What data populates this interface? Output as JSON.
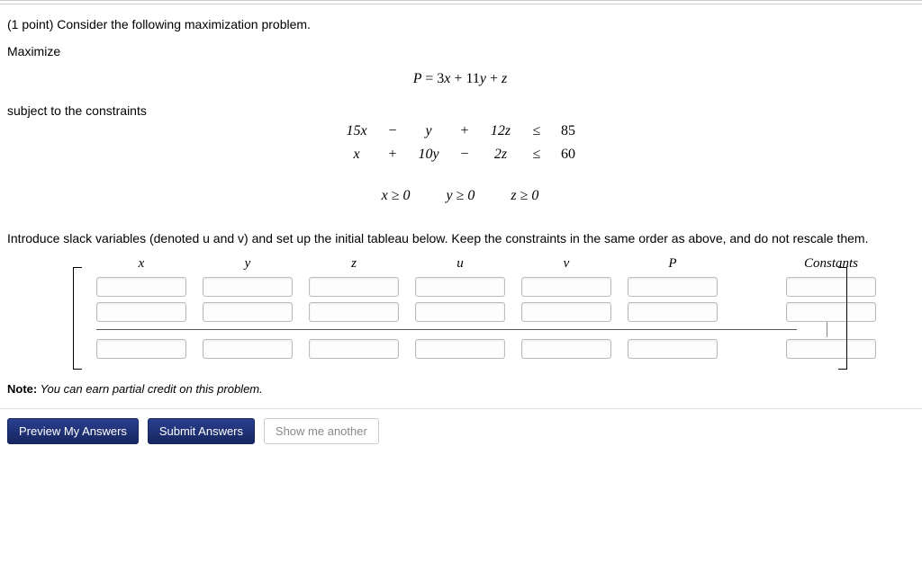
{
  "problem": {
    "points_prefix": "(1 point) ",
    "prompt": "Consider the following maximization problem.",
    "maximize_label": "Maximize",
    "objective": "P = 3x + 11y + z",
    "subject_label": "subject to the constraints",
    "constraints": {
      "r1": {
        "c1": "15x",
        "o1": "−",
        "c2": "y",
        "o2": "+",
        "c3": "12z",
        "rel": "≤",
        "rhs": "85"
      },
      "r2": {
        "c1": "x",
        "o1": "+",
        "c2": "10y",
        "o2": "−",
        "c3": "2z",
        "rel": "≤",
        "rhs": "60"
      }
    },
    "nonneg": {
      "a": "x ≥ 0",
      "b": "y ≥ 0",
      "c": "z ≥ 0"
    },
    "instruction": "Introduce slack variables (denoted u and v) and set up the initial tableau below. Keep the constraints in the same order as above, and do not rescale them.",
    "headers": {
      "x": "x",
      "y": "y",
      "z": "z",
      "u": "u",
      "v": "v",
      "P": "P",
      "const": "Constants"
    }
  },
  "note": {
    "label": "Note:",
    "text": " You can earn partial credit on this problem."
  },
  "buttons": {
    "preview": "Preview My Answers",
    "submit": "Submit Answers",
    "another": "Show me another"
  }
}
